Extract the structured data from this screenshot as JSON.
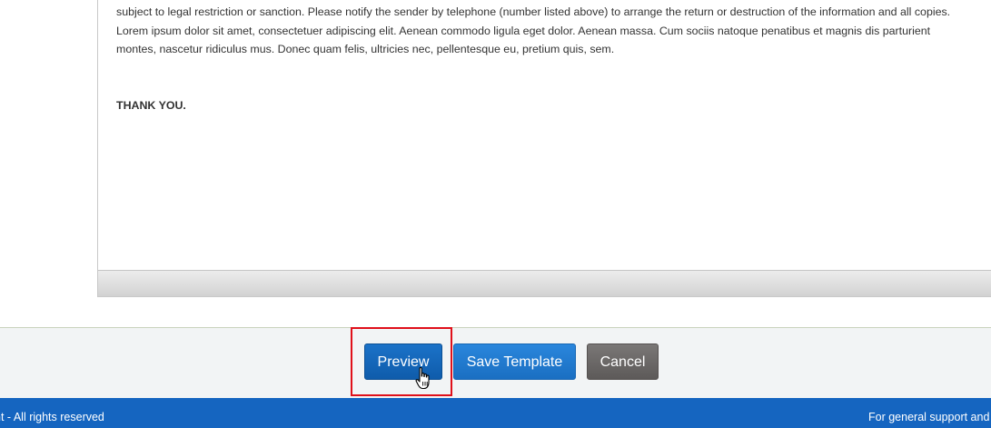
{
  "editor": {
    "lines": [
      "subject to legal restriction or sanction. Please notify the sender by telephone (number listed above) to arrange the return or destruction of the information and all copies.",
      "Lorem ipsum dolor sit amet, consectetuer adipiscing elit. Aenean commodo ligula eget dolor. Aenean massa. Cum sociis natoque penatibus et magnis dis parturient",
      "montes, nascetur ridiculus mus. Donec quam felis, ultricies nec, pellentesque eu, pretium quis, sem."
    ],
    "closing": "THANK YOU."
  },
  "actions": {
    "preview_label": "Preview",
    "save_template_label": "Save Template",
    "cancel_label": "Cancel"
  },
  "footer": {
    "left_text": "nt - All rights reserved",
    "right_text": "For general support and"
  },
  "colors": {
    "primary": "#1565c0",
    "preview_button": "#1b72c8",
    "save_button": "#2a86dc",
    "cancel_button": "#6b6867",
    "highlight": "#e0101a"
  },
  "icons": {
    "cursor": "hand-pointer-icon"
  }
}
